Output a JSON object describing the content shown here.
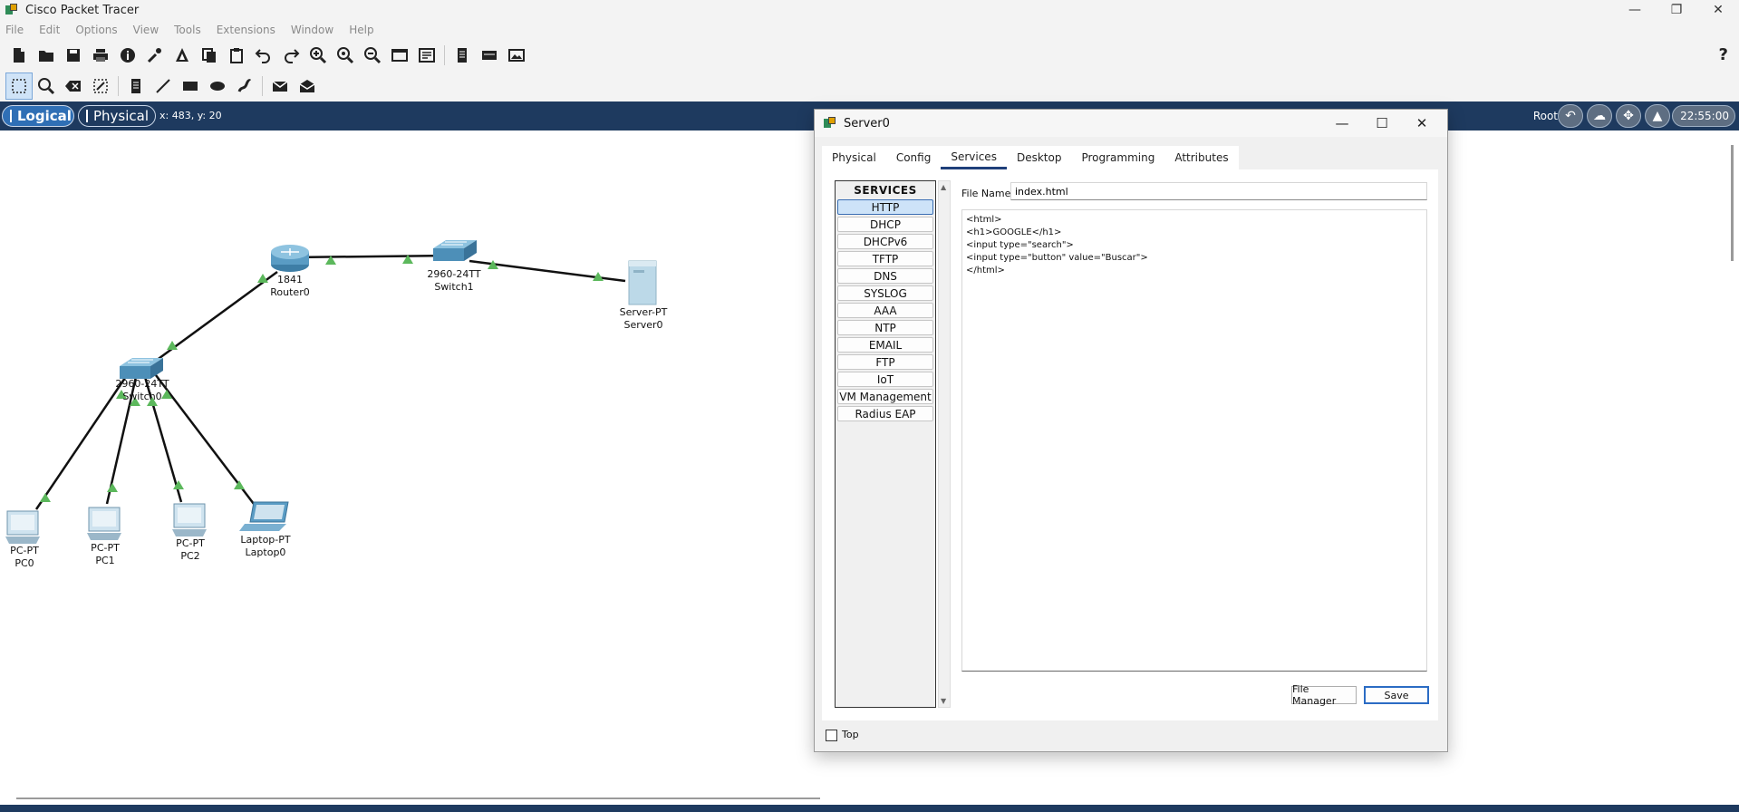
{
  "window": {
    "title": "Cisco Packet Tracer",
    "controls": {
      "minimize": "—",
      "restore": "❐",
      "close": "✕"
    }
  },
  "menu": [
    "File",
    "Edit",
    "Options",
    "View",
    "Tools",
    "Extensions",
    "Window",
    "Help"
  ],
  "toolbar": {
    "help": "?"
  },
  "workspace": {
    "logical_label": "Logical",
    "physical_label": "Physical",
    "coords": "x: 483, y: 20",
    "root_label": "Root",
    "time": "22:55:00"
  },
  "devices": [
    {
      "model": "1841",
      "name": "Router0"
    },
    {
      "model": "2960-24TT",
      "name": "Switch1"
    },
    {
      "model": "Server-PT",
      "name": "Server0"
    },
    {
      "model": "2960-24TT",
      "name": "Switch0"
    },
    {
      "model": "PC-PT",
      "name": "PC0"
    },
    {
      "model": "PC-PT",
      "name": "PC1"
    },
    {
      "model": "PC-PT",
      "name": "PC2"
    },
    {
      "model": "Laptop-PT",
      "name": "Laptop0"
    }
  ],
  "dialog": {
    "title": "Server0",
    "controls": {
      "minimize": "—",
      "maximize": "☐",
      "close": "✕"
    },
    "tabs": [
      "Physical",
      "Config",
      "Services",
      "Desktop",
      "Programming",
      "Attributes"
    ],
    "active_tab": "Services",
    "services_header": "SERVICES",
    "services": [
      "HTTP",
      "DHCP",
      "DHCPv6",
      "TFTP",
      "DNS",
      "SYSLOG",
      "AAA",
      "NTP",
      "EMAIL",
      "FTP",
      "IoT",
      "VM Management",
      "Radius EAP"
    ],
    "active_service": "HTTP",
    "file_name_label": "File Name:",
    "file_name": "index.html",
    "file_content": "<html>\n<h1>GOOGLE</h1>\n<input type=\"search\">\n<input type=\"button\" value=\"Buscar\">\n</html>",
    "file_manager_label": "File Manager",
    "save_label": "Save",
    "top_label": "Top"
  }
}
